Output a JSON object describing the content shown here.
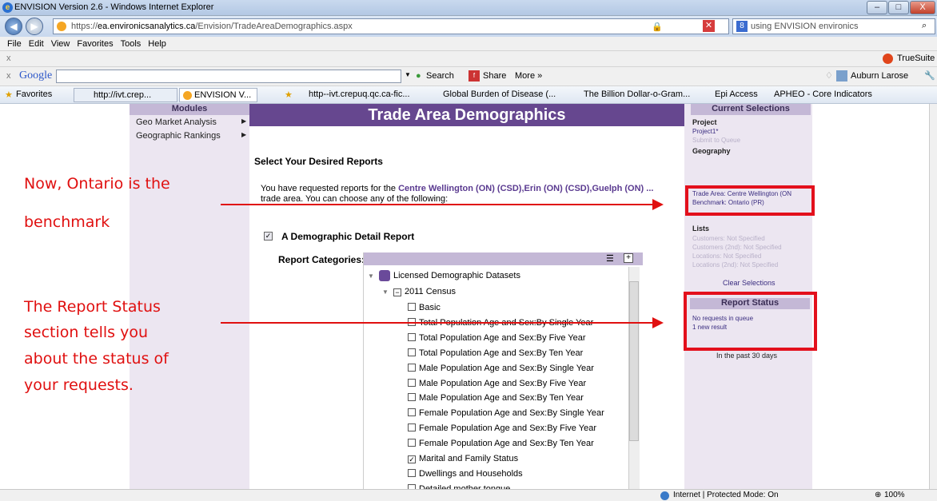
{
  "window": {
    "title": "ENVISION Version 2.6 - Windows Internet Explorer",
    "min": "–",
    "max": "□",
    "close": "X"
  },
  "address": {
    "back": "◀",
    "forward": "▶",
    "url_scheme": "https://",
    "url_host": "ea.environicsanalytics.ca",
    "url_path": "/Envision/TradeAreaDemographics.aspx",
    "search_text": "using ENVISION environics"
  },
  "menu": [
    "File",
    "Edit",
    "View",
    "Favorites",
    "Tools",
    "Help"
  ],
  "truesuite": {
    "close": "x",
    "label": "TrueSuite"
  },
  "google": {
    "close": "x",
    "logo": "Google",
    "search": "Search",
    "share": "Share",
    "more": "More »",
    "user": "Auburn Larose"
  },
  "favorites": {
    "label": "Favorites",
    "tab1": "http://ivt.crep...",
    "tab2": "ENVISION V...",
    "links": [
      "http--ivt.crepuq.qc.ca-fic...",
      "Global Burden of Disease (...",
      "The Billion Dollar-o-Gram...",
      "Epi Access",
      "APHEO - Core Indicators"
    ]
  },
  "modules": {
    "title": "Modules",
    "items": [
      "Geo Market Analysis",
      "Geographic Rankings"
    ]
  },
  "main": {
    "page_title": "Trade Area Demographics",
    "select_heading": "Select Your Desired Reports",
    "intro_prefix": "You have requested reports for the",
    "intro_places": "Centre Wellington (ON) (CSD),Erin (ON) (CSD),Guelph (ON) ...",
    "intro_suffix": "trade area. You can choose any of the following:",
    "demographic_report": "A Demographic Detail Report",
    "report_categories": "Report Categories:"
  },
  "tree": {
    "root": "Licensed Demographic Datasets",
    "group": "2011 Census",
    "items": [
      {
        "label": "Basic",
        "checked": false
      },
      {
        "label": "Total Population Age and Sex:By Single Year",
        "checked": false
      },
      {
        "label": "Total Population Age and Sex:By Five Year",
        "checked": false
      },
      {
        "label": "Total Population Age and Sex:By Ten Year",
        "checked": false
      },
      {
        "label": "Male Population Age and Sex:By Single Year",
        "checked": false
      },
      {
        "label": "Male Population Age and Sex:By Five Year",
        "checked": false
      },
      {
        "label": "Male Population Age and Sex:By Ten Year",
        "checked": false
      },
      {
        "label": "Female Population Age and Sex:By Single Year",
        "checked": false
      },
      {
        "label": "Female Population Age and Sex:By Five Year",
        "checked": false
      },
      {
        "label": "Female Population Age and Sex:By Ten Year",
        "checked": false
      },
      {
        "label": "Marital and Family Status",
        "checked": true
      },
      {
        "label": "Dwellings and Households",
        "checked": false
      },
      {
        "label": "Detailed mother tongue",
        "checked": false
      }
    ]
  },
  "selections": {
    "title": "Current Selections",
    "project_label": "Project",
    "project_name": "Project1*",
    "submit": "Submit to Queue",
    "geography_label": "Geography",
    "trade_area": "Trade Area: Centre Wellington (ON",
    "benchmark": "Benchmark: Ontario (PR)",
    "lists_label": "Lists",
    "customers": "Customers: Not Specified",
    "customers2": "Customers (2nd): Not Specified",
    "locations": "Locations: Not Specified",
    "locations2": "Locations (2nd): Not Specified",
    "clear": "Clear Selections"
  },
  "report_status": {
    "title": "Report Status",
    "queue": "No requests in queue",
    "result": "1 new result",
    "period": "In the past 30 days"
  },
  "annotations": {
    "top": [
      "Now, Ontario is the",
      "benchmark"
    ],
    "bottom": [
      "The Report Status",
      "section tells you",
      "about the status of",
      "your requests."
    ]
  },
  "status": {
    "zone": "Internet | Protected Mode: On",
    "zoom": "100%"
  },
  "colors": {
    "accent": "#66478f",
    "annotation": "#e01010",
    "panel": "#ece6f1"
  }
}
